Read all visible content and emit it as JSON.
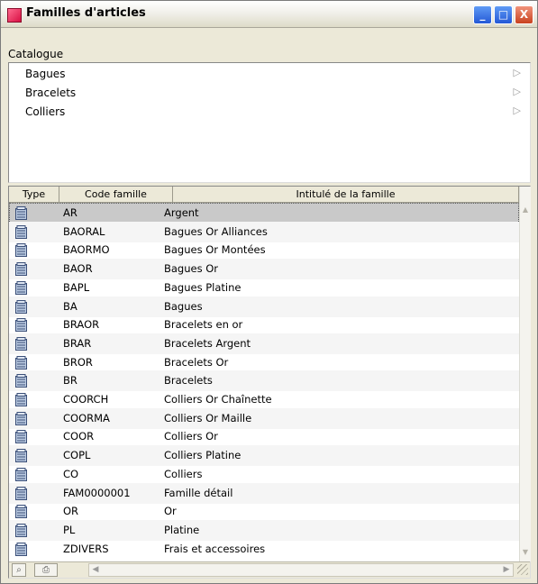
{
  "window": {
    "title": "Familles d'articles",
    "min_glyph": "_",
    "max_glyph": "□",
    "close_glyph": "X"
  },
  "catalog": {
    "label": "Catalogue",
    "items": [
      {
        "label": "Bagues",
        "arrow": "▷"
      },
      {
        "label": "Bracelets",
        "arrow": "▷"
      },
      {
        "label": "Colliers",
        "arrow": "▷"
      }
    ]
  },
  "table": {
    "headers": {
      "type": "Type",
      "code": "Code famille",
      "label": "Intitulé de la famille"
    },
    "rows": [
      {
        "code": "AR",
        "label": "Argent"
      },
      {
        "code": "BAORAL",
        "label": "Bagues Or Alliances"
      },
      {
        "code": "BAORMO",
        "label": "Bagues Or Montées"
      },
      {
        "code": "BAOR",
        "label": "Bagues Or"
      },
      {
        "code": "BAPL",
        "label": "Bagues Platine"
      },
      {
        "code": "BA",
        "label": "Bagues"
      },
      {
        "code": "BRAOR",
        "label": "Bracelets en or"
      },
      {
        "code": "BRAR",
        "label": "Bracelets Argent"
      },
      {
        "code": "BROR",
        "label": "Bracelets Or"
      },
      {
        "code": "BR",
        "label": "Bracelets"
      },
      {
        "code": "COORCH",
        "label": "Colliers Or Chaînette"
      },
      {
        "code": "COORMA",
        "label": "Colliers Or Maille"
      },
      {
        "code": "COOR",
        "label": "Colliers Or"
      },
      {
        "code": "COPL",
        "label": "Colliers Platine"
      },
      {
        "code": "CO",
        "label": "Colliers"
      },
      {
        "code": "FAM0000001",
        "label": "Famille détail"
      },
      {
        "code": "OR",
        "label": "Or"
      },
      {
        "code": "PL",
        "label": "Platine"
      },
      {
        "code": "ZDIVERS",
        "label": "Frais et accessoires"
      }
    ],
    "selected_index": 0
  },
  "scrollbar": {
    "up": "▲",
    "down": "▼",
    "left": "◀",
    "right": "▶"
  },
  "statusbar": {
    "search_icon": "⌕",
    "print_icon": "⎙"
  },
  "colors": {
    "accent": "#316ac5",
    "selection": "#c9c9c9",
    "close_red": "#c9421f"
  }
}
